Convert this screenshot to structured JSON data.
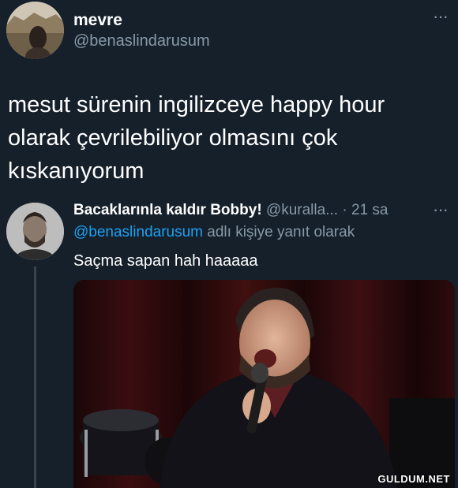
{
  "tweet": {
    "author_name": "mevre",
    "author_handle": "@benaslindarusum",
    "more_label": "···",
    "text": "mesut sürenin ingilizceye happy hour olarak çevrilebiliyor olmasını çok kıskanıyorum"
  },
  "reply": {
    "author_name": "Bacaklarınla kaldır Bobby!",
    "author_handle": "@kuralla...",
    "separator": "·",
    "time": "21 sa",
    "more_label": "···",
    "reply_to_link": "@benaslindarusum",
    "reply_to_suffix": "adlı kişiye yanıt olarak",
    "text": "Saçma sapan hah haaaaa"
  },
  "watermark": "GULDUM.NET",
  "colors": {
    "background": "#15202b",
    "link": "#1da1f2",
    "secondary_text": "#8899a6"
  }
}
